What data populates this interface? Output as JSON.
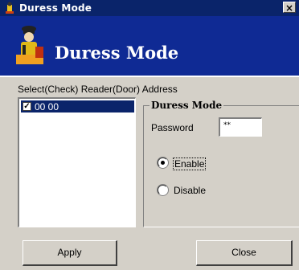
{
  "window": {
    "title": "Duress Mode",
    "close_glyph": "×",
    "icon": "door-guard-icon"
  },
  "banner": {
    "title": "Duress Mode",
    "icon": "door-guard-icon",
    "background": "#0f2a94"
  },
  "reader_list": {
    "label": "Select(Check) Reader(Door) Address",
    "items": [
      {
        "label": "00 00",
        "checked": true,
        "check_glyph": "✓"
      }
    ]
  },
  "duress_group": {
    "title": "Duress Mode",
    "password_label": "Password",
    "password_value": "**",
    "options": [
      {
        "label": "Enable",
        "selected": true
      },
      {
        "label": "Disable",
        "selected": false
      }
    ]
  },
  "buttons": {
    "apply": "Apply",
    "close": "Close"
  },
  "colors": {
    "titlebar": "#0a246a",
    "selection": "#0a246a",
    "face": "#d4d0c8"
  }
}
